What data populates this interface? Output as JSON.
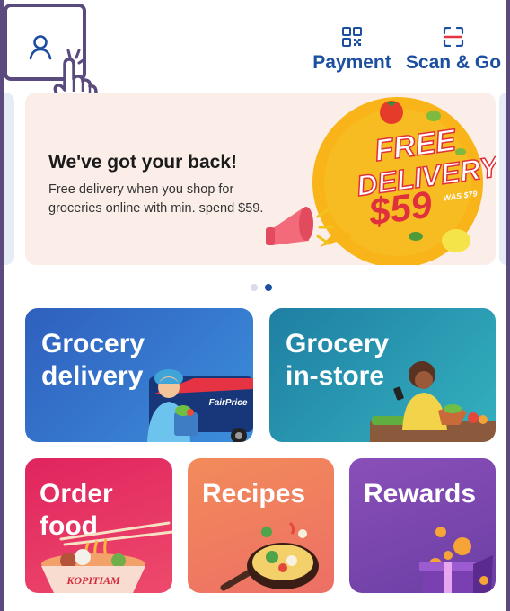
{
  "header": {
    "payment_label": "Payment",
    "scan_label": "Scan & Go"
  },
  "banner": {
    "title": "We've got your back!",
    "description": "Free delivery when you shop for groceries online with min. spend $59.",
    "promo_line1": "FREE",
    "promo_line2": "DELIVERY",
    "promo_price": "$59",
    "promo_was": "WAS $79"
  },
  "carousel": {
    "pages": 2,
    "active_index": 1
  },
  "tiles": {
    "grocery_delivery": "Grocery delivery",
    "grocery_instore": "Grocery in-store",
    "order_food": "Order food",
    "recipes": "Recipes",
    "rewards": "Rewards",
    "fairprice_logo": "FairPrice",
    "kopitiam_logo": "KOPITIAM"
  },
  "colors": {
    "brand_blue": "#1d4fa0",
    "highlight_purple": "#5b4a7d"
  }
}
